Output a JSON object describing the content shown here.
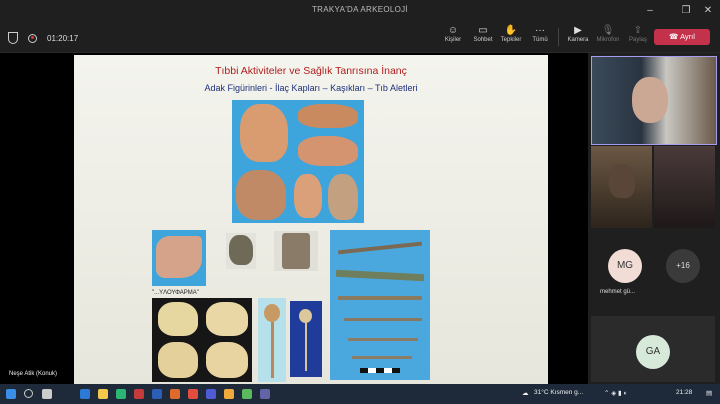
{
  "window": {
    "title": "TRAKYA'DA ARKEOLOJİ"
  },
  "toolbar": {
    "timer": "01:20:17",
    "buttons": [
      {
        "label": "Kişiler",
        "icon": "people-icon"
      },
      {
        "label": "Sohbet",
        "icon": "chat-icon"
      },
      {
        "label": "Tepkiler",
        "icon": "reactions-icon"
      },
      {
        "label": "Tümü",
        "icon": "more-icon"
      },
      {
        "label": "Kamera",
        "icon": "camera-icon"
      },
      {
        "label": "Mikrofon",
        "icon": "microphone-icon"
      },
      {
        "label": "Paylaş",
        "icon": "share-icon"
      }
    ],
    "leave_label": "Ayrıl"
  },
  "slide": {
    "title": "Tıbbi Aktiviteler ve Sağlık Tanrısına İnanç",
    "subtitle": "Adak Figürinleri - İlaç Kapları – Kaşıkları – Tıb Aletleri",
    "greek_caption": "\"...YΛΟΥΦΑΡΜΑ\""
  },
  "presenter": {
    "name": "Neşe Atik (Konuk)"
  },
  "participants": [
    {
      "initials": "MG",
      "name": "mehmet gü...",
      "color": "#f1ddd6"
    },
    {
      "initials": "GA",
      "name": "",
      "color": "#d7ead9"
    }
  ],
  "overflow": {
    "label": "+16"
  },
  "taskbar": {
    "weather": "31°C  Kısmen g...",
    "time": "21:28"
  }
}
